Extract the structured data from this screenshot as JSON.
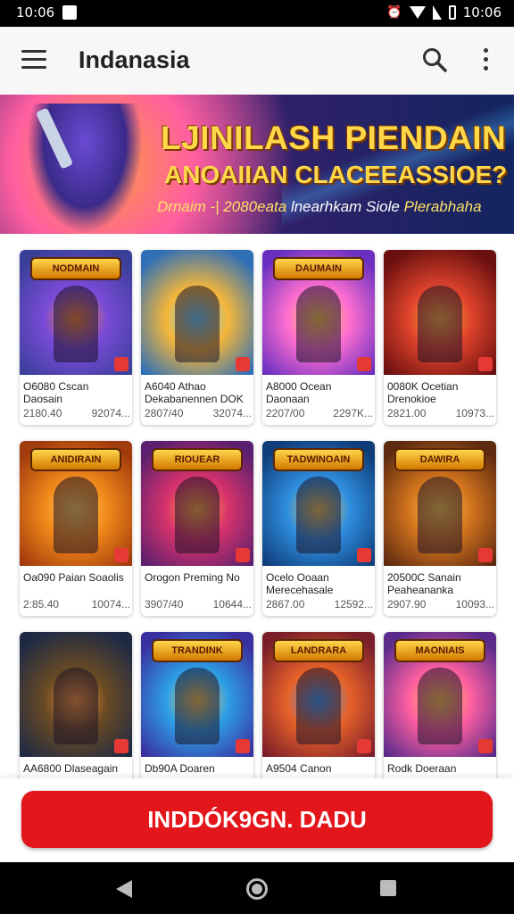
{
  "status_bar": {
    "time_left": "10:06",
    "time_right": "10:06"
  },
  "app_bar": {
    "title": "Indanasia"
  },
  "banner": {
    "line1": "LJINILASH PIENDAIN",
    "line2": "ANOAIIAN CLACEEASSIOE?",
    "line3_a": "Drnaim -| 2080eata",
    "line3_b": "lnearhkam Siole",
    "line3_c": "Plerabhaha"
  },
  "games": [
    {
      "name": "O6080 Cscan Daosain",
      "a": "2180.40",
      "b": "92074...",
      "colors": [
        "#3a3f9a",
        "#7a4bd8",
        "#ff8a2a"
      ]
    },
    {
      "name": "A6040 Athao Dekabanennen DOK",
      "a": "2807/40",
      "b": "32074...",
      "colors": [
        "#2e6fb8",
        "#f4b63a",
        "#6bd0ff"
      ]
    },
    {
      "name": "A8000 Ocean Daonaan",
      "a": "2207/00",
      "b": "2297K...",
      "colors": [
        "#6a2fc1",
        "#ff6fd0",
        "#ffd04a"
      ]
    },
    {
      "name": "0080K Ocetian Drenokioe",
      "a": "2821.00",
      "b": "10973...",
      "colors": [
        "#6a0f0f",
        "#e0442c",
        "#ffb13a"
      ]
    },
    {
      "name": "Oa090 Paian Soaolis",
      "a": "2:85.40",
      "b": "10074...",
      "colors": [
        "#a13a0c",
        "#f38a1b",
        "#ffd25a"
      ]
    },
    {
      "name": "Orogon Preming No",
      "a": "3907/40",
      "b": "10644...",
      "colors": [
        "#5a1f6e",
        "#d9336c",
        "#ffb13a"
      ]
    },
    {
      "name": "Ocelo Ooaan Merecehasale",
      "a": "2867.00",
      "b": "12592...",
      "colors": [
        "#0f3d7a",
        "#2f8fe0",
        "#f3c74a"
      ]
    },
    {
      "name": "20500C Sanain Peaheananka",
      "a": "2907.90",
      "b": "10093...",
      "colors": [
        "#5e2a10",
        "#d4751e",
        "#ffcc4a"
      ]
    },
    {
      "name": "AA6800 Dlaseagain",
      "a": "",
      "b": "",
      "colors": [
        "#1e2a44",
        "#6a4a24",
        "#ff9a3a"
      ]
    },
    {
      "name": "Db90A Doaren",
      "a": "",
      "b": "",
      "colors": [
        "#3a2fa0",
        "#2d9fe6",
        "#ffcd4a"
      ]
    },
    {
      "name": "A9504 Canon",
      "a": "",
      "b": "",
      "colors": [
        "#7a1e2a",
        "#e8622a",
        "#3aa0ff"
      ]
    },
    {
      "name": "Rodk Doeraan",
      "a": "",
      "b": "",
      "colors": [
        "#5a2b8c",
        "#ff5fa0",
        "#ffcf4a"
      ]
    }
  ],
  "game_logos": [
    "NODMAIN",
    "",
    "DAUMAIN",
    "",
    "ANIDIRAIN",
    "RIOUEAR",
    "TADWINOAIN",
    "DAWIRA",
    "",
    "TRANDINK",
    "LANDRARA",
    "MAONIAIS"
  ],
  "cta": {
    "label": "INDDÓK9GN. DADU"
  }
}
